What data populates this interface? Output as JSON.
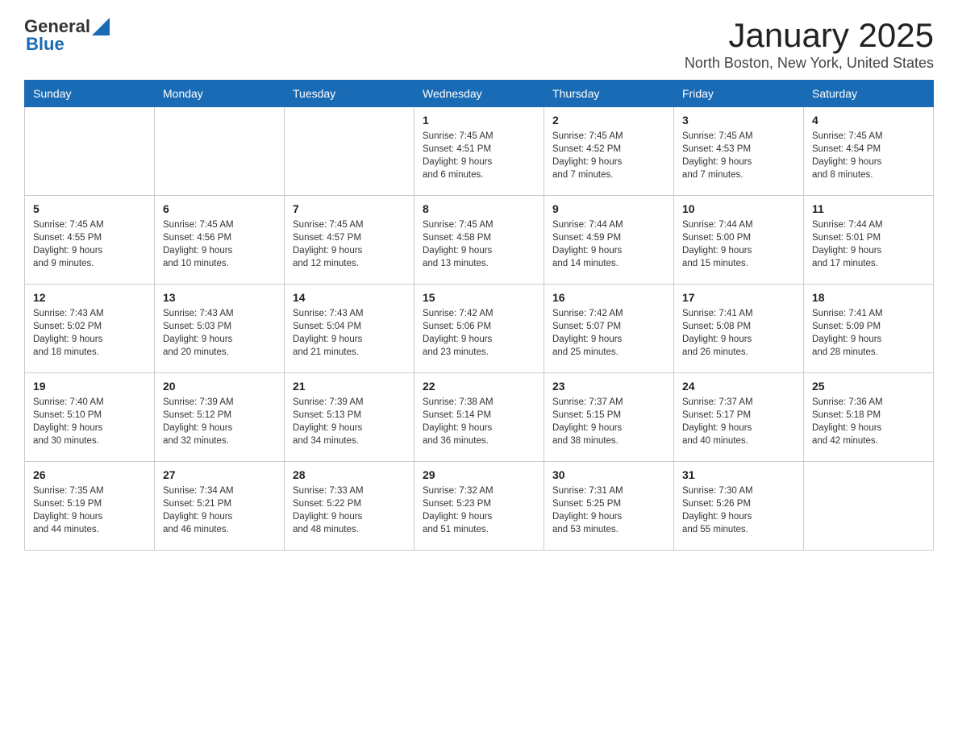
{
  "header": {
    "logo": {
      "text1": "General",
      "text2": "Blue"
    },
    "title": "January 2025",
    "subtitle": "North Boston, New York, United States"
  },
  "days_of_week": [
    "Sunday",
    "Monday",
    "Tuesday",
    "Wednesday",
    "Thursday",
    "Friday",
    "Saturday"
  ],
  "weeks": [
    [
      {
        "day": "",
        "info": ""
      },
      {
        "day": "",
        "info": ""
      },
      {
        "day": "",
        "info": ""
      },
      {
        "day": "1",
        "info": "Sunrise: 7:45 AM\nSunset: 4:51 PM\nDaylight: 9 hours\nand 6 minutes."
      },
      {
        "day": "2",
        "info": "Sunrise: 7:45 AM\nSunset: 4:52 PM\nDaylight: 9 hours\nand 7 minutes."
      },
      {
        "day": "3",
        "info": "Sunrise: 7:45 AM\nSunset: 4:53 PM\nDaylight: 9 hours\nand 7 minutes."
      },
      {
        "day": "4",
        "info": "Sunrise: 7:45 AM\nSunset: 4:54 PM\nDaylight: 9 hours\nand 8 minutes."
      }
    ],
    [
      {
        "day": "5",
        "info": "Sunrise: 7:45 AM\nSunset: 4:55 PM\nDaylight: 9 hours\nand 9 minutes."
      },
      {
        "day": "6",
        "info": "Sunrise: 7:45 AM\nSunset: 4:56 PM\nDaylight: 9 hours\nand 10 minutes."
      },
      {
        "day": "7",
        "info": "Sunrise: 7:45 AM\nSunset: 4:57 PM\nDaylight: 9 hours\nand 12 minutes."
      },
      {
        "day": "8",
        "info": "Sunrise: 7:45 AM\nSunset: 4:58 PM\nDaylight: 9 hours\nand 13 minutes."
      },
      {
        "day": "9",
        "info": "Sunrise: 7:44 AM\nSunset: 4:59 PM\nDaylight: 9 hours\nand 14 minutes."
      },
      {
        "day": "10",
        "info": "Sunrise: 7:44 AM\nSunset: 5:00 PM\nDaylight: 9 hours\nand 15 minutes."
      },
      {
        "day": "11",
        "info": "Sunrise: 7:44 AM\nSunset: 5:01 PM\nDaylight: 9 hours\nand 17 minutes."
      }
    ],
    [
      {
        "day": "12",
        "info": "Sunrise: 7:43 AM\nSunset: 5:02 PM\nDaylight: 9 hours\nand 18 minutes."
      },
      {
        "day": "13",
        "info": "Sunrise: 7:43 AM\nSunset: 5:03 PM\nDaylight: 9 hours\nand 20 minutes."
      },
      {
        "day": "14",
        "info": "Sunrise: 7:43 AM\nSunset: 5:04 PM\nDaylight: 9 hours\nand 21 minutes."
      },
      {
        "day": "15",
        "info": "Sunrise: 7:42 AM\nSunset: 5:06 PM\nDaylight: 9 hours\nand 23 minutes."
      },
      {
        "day": "16",
        "info": "Sunrise: 7:42 AM\nSunset: 5:07 PM\nDaylight: 9 hours\nand 25 minutes."
      },
      {
        "day": "17",
        "info": "Sunrise: 7:41 AM\nSunset: 5:08 PM\nDaylight: 9 hours\nand 26 minutes."
      },
      {
        "day": "18",
        "info": "Sunrise: 7:41 AM\nSunset: 5:09 PM\nDaylight: 9 hours\nand 28 minutes."
      }
    ],
    [
      {
        "day": "19",
        "info": "Sunrise: 7:40 AM\nSunset: 5:10 PM\nDaylight: 9 hours\nand 30 minutes."
      },
      {
        "day": "20",
        "info": "Sunrise: 7:39 AM\nSunset: 5:12 PM\nDaylight: 9 hours\nand 32 minutes."
      },
      {
        "day": "21",
        "info": "Sunrise: 7:39 AM\nSunset: 5:13 PM\nDaylight: 9 hours\nand 34 minutes."
      },
      {
        "day": "22",
        "info": "Sunrise: 7:38 AM\nSunset: 5:14 PM\nDaylight: 9 hours\nand 36 minutes."
      },
      {
        "day": "23",
        "info": "Sunrise: 7:37 AM\nSunset: 5:15 PM\nDaylight: 9 hours\nand 38 minutes."
      },
      {
        "day": "24",
        "info": "Sunrise: 7:37 AM\nSunset: 5:17 PM\nDaylight: 9 hours\nand 40 minutes."
      },
      {
        "day": "25",
        "info": "Sunrise: 7:36 AM\nSunset: 5:18 PM\nDaylight: 9 hours\nand 42 minutes."
      }
    ],
    [
      {
        "day": "26",
        "info": "Sunrise: 7:35 AM\nSunset: 5:19 PM\nDaylight: 9 hours\nand 44 minutes."
      },
      {
        "day": "27",
        "info": "Sunrise: 7:34 AM\nSunset: 5:21 PM\nDaylight: 9 hours\nand 46 minutes."
      },
      {
        "day": "28",
        "info": "Sunrise: 7:33 AM\nSunset: 5:22 PM\nDaylight: 9 hours\nand 48 minutes."
      },
      {
        "day": "29",
        "info": "Sunrise: 7:32 AM\nSunset: 5:23 PM\nDaylight: 9 hours\nand 51 minutes."
      },
      {
        "day": "30",
        "info": "Sunrise: 7:31 AM\nSunset: 5:25 PM\nDaylight: 9 hours\nand 53 minutes."
      },
      {
        "day": "31",
        "info": "Sunrise: 7:30 AM\nSunset: 5:26 PM\nDaylight: 9 hours\nand 55 minutes."
      },
      {
        "day": "",
        "info": ""
      }
    ]
  ]
}
